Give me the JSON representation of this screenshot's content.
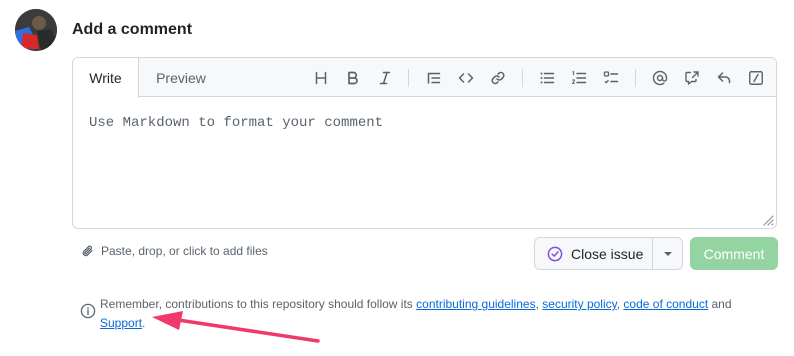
{
  "heading": "Add a comment",
  "tabs": {
    "write": "Write",
    "preview": "Preview"
  },
  "toolbar": {
    "icons": [
      "heading-icon",
      "bold-icon",
      "italic-icon",
      "quote-icon",
      "code-icon",
      "link-icon",
      "unordered-list-icon",
      "ordered-list-icon",
      "task-list-icon",
      "mention-icon",
      "reference-icon",
      "saved-reply-icon",
      "slash-commands-icon"
    ]
  },
  "editor": {
    "placeholder": "Use Markdown to format your comment"
  },
  "attach": {
    "label": "Paste, drop, or click to add files"
  },
  "buttons": {
    "close_issue": "Close issue",
    "comment": "Comment"
  },
  "note": {
    "prefix": "Remember, contributions to this repository should follow its",
    "link1": "contributing guidelines",
    "sep1": ",",
    "link2": "security policy",
    "sep2": ",",
    "link3": "code of conduct",
    "and": "and",
    "link4": "Support",
    "end": "."
  },
  "colors": {
    "comment_button_disabled": "#94d3a2",
    "link": "#0969da",
    "close_issue_icon": "#8250df",
    "annotation_arrow": "#f0386b"
  }
}
